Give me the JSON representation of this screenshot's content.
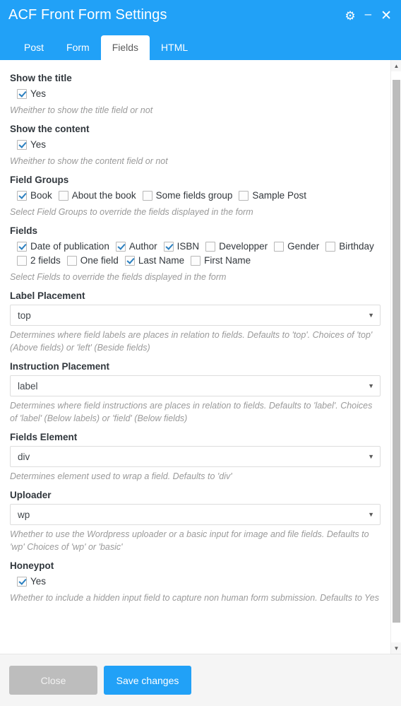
{
  "window": {
    "title": "ACF Front Form Settings",
    "controls": [
      {
        "name": "settings-gear",
        "glyph": "⚙"
      },
      {
        "name": "minimize",
        "glyph": "–"
      },
      {
        "name": "close",
        "glyph": "✕"
      }
    ]
  },
  "tabs": [
    {
      "label": "Post",
      "active": false
    },
    {
      "label": "Form",
      "active": false
    },
    {
      "label": "Fields",
      "active": true
    },
    {
      "label": "HTML",
      "active": false
    }
  ],
  "sections": {
    "show_title": {
      "label": "Show the title",
      "checkbox": {
        "label": "Yes",
        "checked": true
      },
      "hint": "Wheither to show the title field or not"
    },
    "show_content": {
      "label": "Show the content",
      "checkbox": {
        "label": "Yes",
        "checked": true
      },
      "hint": "Wheither to show the content field or not"
    },
    "field_groups": {
      "label": "Field Groups",
      "options": [
        {
          "label": "Book",
          "checked": true
        },
        {
          "label": "About the book",
          "checked": false
        },
        {
          "label": "Some fields group",
          "checked": false
        },
        {
          "label": "Sample Post",
          "checked": false
        }
      ],
      "hint": "Select Field Groups to override the fields displayed in the form"
    },
    "fields": {
      "label": "Fields",
      "options": [
        {
          "label": "Date of publication",
          "checked": true
        },
        {
          "label": "Author",
          "checked": true
        },
        {
          "label": "ISBN",
          "checked": true
        },
        {
          "label": "Developper",
          "checked": false
        },
        {
          "label": "Gender",
          "checked": false
        },
        {
          "label": "Birthday",
          "checked": false
        },
        {
          "label": "2 fields",
          "checked": false
        },
        {
          "label": "One field",
          "checked": false
        },
        {
          "label": "Last Name",
          "checked": true
        },
        {
          "label": "First Name",
          "checked": false
        }
      ],
      "hint": "Select Fields to override the fields displayed in the form"
    },
    "label_placement": {
      "label": "Label Placement",
      "value": "top",
      "arrow": "▼",
      "hint": "Determines where field labels are places in relation to fields. Defaults to 'top'. Choices of 'top' (Above fields) or 'left' (Beside fields)"
    },
    "instruction_placement": {
      "label": "Instruction Placement",
      "value": "label",
      "arrow": "▼",
      "hint": "Determines where field instructions are places in relation to fields. Defaults to 'label'. Choices of 'label' (Below labels) or 'field' (Below fields)"
    },
    "fields_element": {
      "label": "Fields Element",
      "value": "div",
      "arrow": "▼",
      "hint": "Determines element used to wrap a field. Defaults to 'div'"
    },
    "uploader": {
      "label": "Uploader",
      "value": "wp",
      "arrow": "▼",
      "hint": "Whether to use the Wordpress uploader or a basic input for image and file fields. Defaults to 'wp' Choices of 'wp' or 'basic'"
    },
    "honeypot": {
      "label": "Honeypot",
      "checkbox": {
        "label": "Yes",
        "checked": true
      },
      "hint": "Whether to include a hidden input field to capture non human form submission. Defaults to Yes"
    }
  },
  "scrollbar": {
    "up_arrow": "▲",
    "down_arrow": "▼"
  },
  "footer": {
    "close_label": "Close",
    "save_label": "Save changes"
  },
  "colors": {
    "accent": "#21a1f7",
    "close_button": "#bdbdbd",
    "hint_text": "#9a9a9a"
  }
}
